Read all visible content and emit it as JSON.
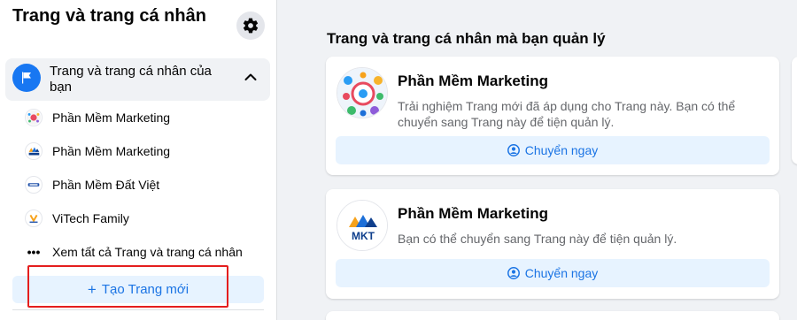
{
  "sidebar": {
    "title": "Trang và trang cá nhân",
    "section": {
      "label": "Trang và trang cá nhân của bạn"
    },
    "pages": [
      {
        "label": "Phần Mềm Marketing",
        "icon": "infographic-logo-icon"
      },
      {
        "label": "Phần Mềm Marketing",
        "icon": "mkt-logo-icon"
      },
      {
        "label": "Phần Mềm Đất Việt",
        "icon": "datviet-logo-icon"
      },
      {
        "label": "ViTech Family",
        "icon": "vitech-logo-icon"
      }
    ],
    "see_all": {
      "dots": "•••",
      "label": "Xem tất cả Trang và trang cá nhân"
    },
    "create_button": {
      "plus": "+",
      "label": "Tạo Trang mới"
    }
  },
  "main": {
    "heading": "Trang và trang cá nhân mà bạn quản lý",
    "cards": [
      {
        "name": "Phần Mềm Marketing",
        "description": "Trải nghiệm Trang mới đã áp dụng cho Trang này. Bạn có thể chuyển sang Trang này để tiện quản lý.",
        "button_label": "Chuyển ngay"
      },
      {
        "name": "Phần Mềm Marketing",
        "description": "Bạn có thể chuyển sang Trang này để tiện quản lý.",
        "button_label": "Chuyển ngay",
        "logo_text": "MKT"
      }
    ]
  },
  "colors": {
    "accent": "#1877f2",
    "button_bg": "#e7f3ff",
    "button_text": "#1b74e4",
    "highlight": "#e41e1e",
    "page_bg": "#f0f2f5"
  }
}
